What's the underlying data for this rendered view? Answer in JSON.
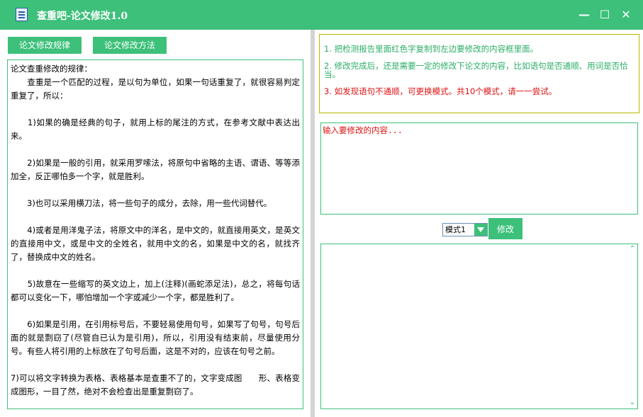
{
  "window": {
    "title": "查重吧-论文修改1.0",
    "controls": {
      "minimize": "—",
      "maximize": "☐",
      "close": "✕"
    }
  },
  "left_panel": {
    "buttons": {
      "rules": "论文修改规律",
      "methods": "论文修改方法"
    },
    "rules_text": [
      "论文查重修改的规律：",
      "　　查重是一个匹配的过程，是以句为单位，如果一句话重复了，就很容易判定重复了，所以：",
      "　　1)如果的确是经典的句子，就用上标的尾注的方式，在参考文献中表达出来。",
      "　　2)如果是一般的引用，就采用罗嗦法，将原句中省略的主语、谓语、等等添加全，反正哪怕多一个字，就是胜利。",
      "　　3)也可以采用横刀法，将一些句子的成分，去除，用一些代词替代。",
      "　　4)或者是用洋鬼子法，将原文中的洋名，是中文的，就直接用英文，是英文的直接用中文，或是中文的全姓名，就用中文的名，如果是中文的名，就找齐了，替换成中文的姓名。",
      "　　5)故意在一些缩写的英文边上，加上(注释)(画蛇添足法)，总之，将每句话都可以变化一下，哪怕增加一个字或减少一个字，都是胜利了。",
      "　　6)如果是引用，在引用标号后，不要轻易使用句号，如果写了句号，句号后面的就是剽窃了(尽管自已认为是引用)，所以，引用没有结束前，尽量使用分号。有些人将引用的上标放在了句号后面，这是不对的，应该在句号之前。",
      "7)可以将文字转换为表格、表格基本是查重不了的，文字变成图　　形、表格变成图形，一目了然，绝对不会检查出是重复剽窃了。"
    ]
  },
  "right_panel": {
    "tips": [
      {
        "text": "1. 把检测报告里面红色字复制到左边要修改的内容框里面。",
        "color": "#2aae67"
      },
      {
        "text": "2. 修改完成后，还是需要一定的修改下论文的内容，比如语句是否通顺、用词是否恰当。",
        "color": "#2aae67"
      },
      {
        "text": "3. 如发现语句不通顺，可更换模式。共10个模式，请一一尝试。",
        "color": "#dd1111"
      }
    ],
    "input": {
      "placeholder": "输入要修改的内容...",
      "value": ""
    },
    "mode": {
      "selected": "模式1"
    },
    "modify_button": "修改",
    "output": {
      "value": ""
    }
  },
  "colors": {
    "accent": "#3dc07a",
    "tip_green": "#2aae67",
    "tip_red": "#dd1111",
    "tips_border": "#b8b800"
  }
}
